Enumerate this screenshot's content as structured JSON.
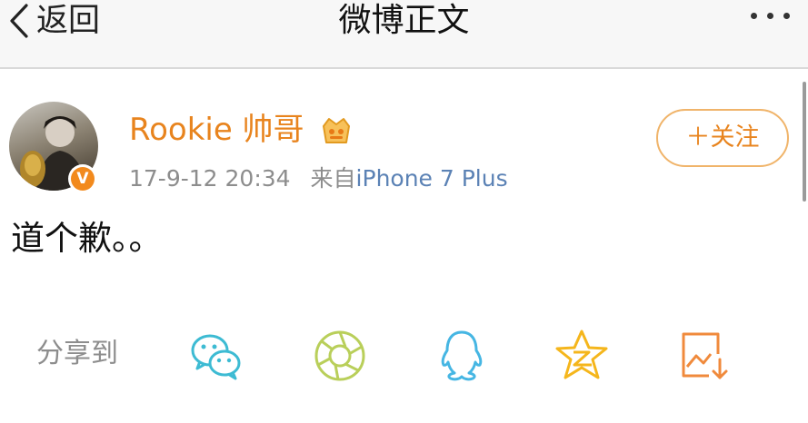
{
  "navbar": {
    "back_label": "返回",
    "title": "微博正文",
    "more_icon": "more-dots-icon"
  },
  "author": {
    "name": "Rookie 帅哥",
    "verified_badge": "V",
    "timestamp": "17-9-12 20:34",
    "source_prefix": "来自",
    "source": "iPhone 7 Plus",
    "follow_label": "＋关注"
  },
  "post": {
    "text": "道个歉。。"
  },
  "share": {
    "label": "分享到",
    "targets": [
      "wechat-icon",
      "moments-icon",
      "qq-icon",
      "qzone-icon",
      "save-image-icon"
    ]
  },
  "colors": {
    "accent": "#e8841e",
    "follow_border": "#f0b46a",
    "meta_gray": "#8d8d8d",
    "source_blue": "#5b82b5",
    "wechat": "#3dbbd3",
    "moments": "#b9cf5a",
    "qq": "#46b6e3",
    "qzone": "#f5b61c",
    "save": "#f08a3c"
  }
}
